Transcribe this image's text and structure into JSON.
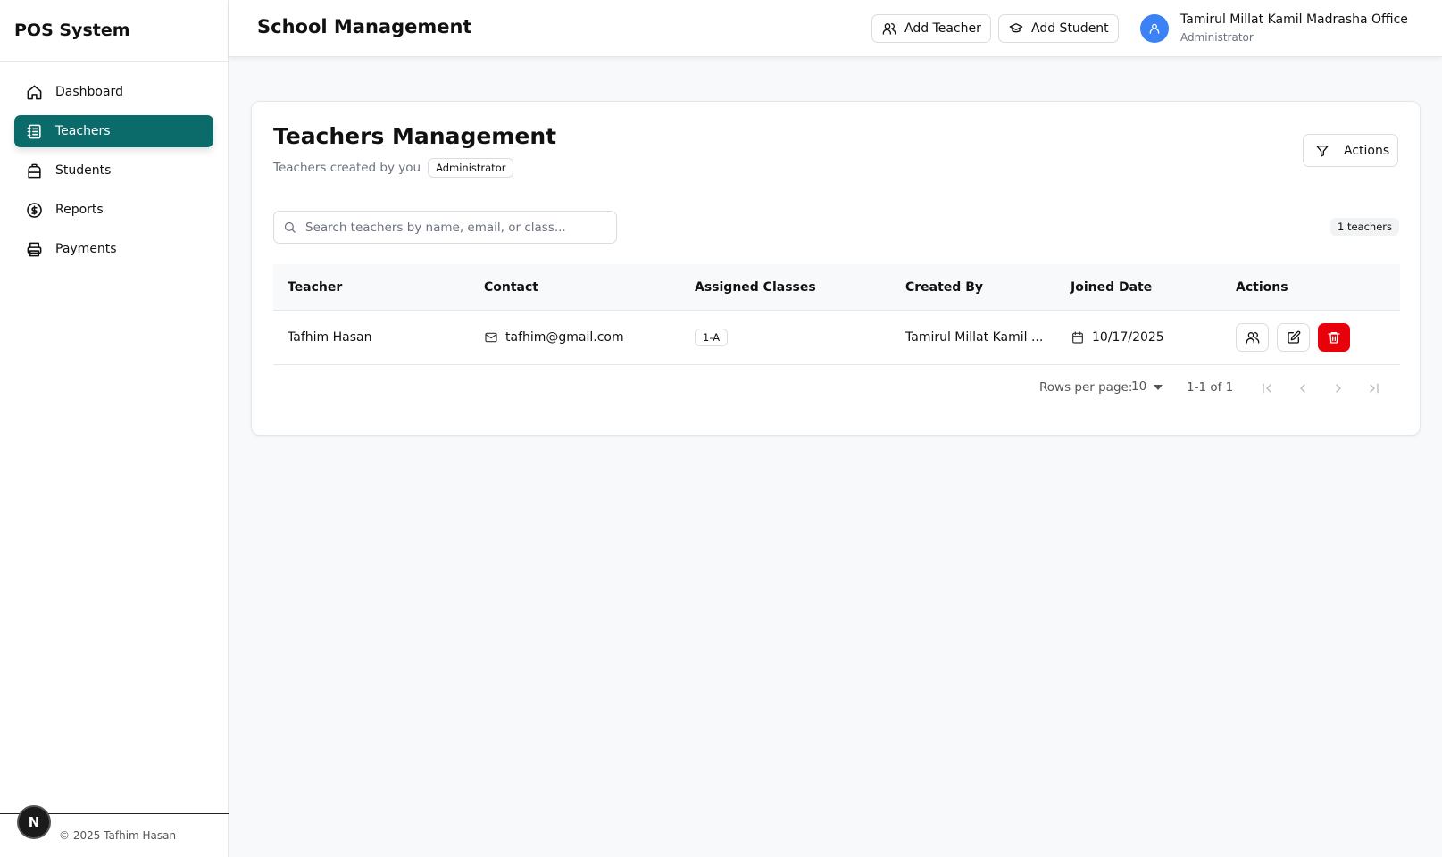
{
  "sidebar": {
    "brand": "POS System",
    "items": [
      {
        "label": "Dashboard",
        "icon": "home-icon"
      },
      {
        "label": "Teachers",
        "icon": "notebook-icon",
        "active": true
      },
      {
        "label": "Students",
        "icon": "backpack-icon"
      },
      {
        "label": "Reports",
        "icon": "dollar-circle-icon"
      },
      {
        "label": "Payments",
        "icon": "printer-icon"
      }
    ],
    "footer": "© 2025 Tafhim Hasan",
    "n_badge": "N"
  },
  "header": {
    "title": "School Management",
    "add_teacher": "Add Teacher",
    "add_student": "Add Student",
    "user_name": "Tamirul Millat Kamil Madrasha Office",
    "user_role": "Administrator"
  },
  "card": {
    "title": "Teachers Management",
    "subtitle": "Teachers created by you",
    "role_badge": "Administrator",
    "actions_label": "Actions",
    "search_placeholder": "Search teachers by name, email, or class...",
    "count_badge": "1 teachers"
  },
  "table": {
    "headers": [
      "Teacher",
      "Contact",
      "Assigned Classes",
      "Created By",
      "Joined Date",
      "Actions"
    ],
    "rows": [
      {
        "teacher": "Tafhim Hasan",
        "contact": "tafhim@gmail.com",
        "class": "1-A",
        "created_by": "Tamirul Millat Kamil ...",
        "joined": "10/17/2025"
      }
    ]
  },
  "pagination": {
    "rows_per_page_label": "Rows per page:",
    "rows_per_page": "10",
    "range": "1-1 of 1"
  },
  "colors": {
    "accent": "#0b6b6b",
    "avatar": "#3b82f6",
    "danger": "#e8000b"
  }
}
